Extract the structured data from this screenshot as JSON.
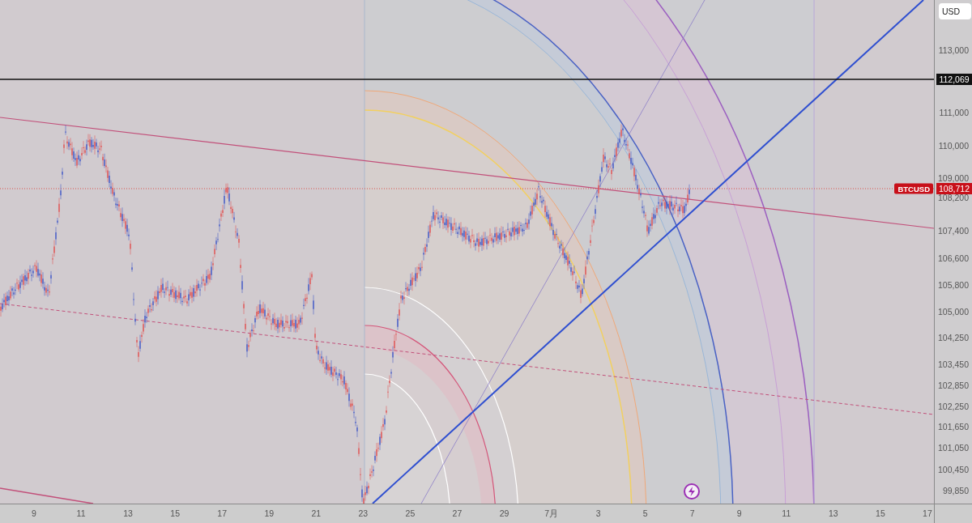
{
  "currency": "USD",
  "price_axis": {
    "ticks": [
      "113,000",
      "111,000",
      "110,000",
      "109,000",
      "108,200",
      "107,400",
      "106,600",
      "105,800",
      "105,000",
      "104,250",
      "103,450",
      "102,850",
      "102,250",
      "101,650",
      "101,050",
      "100,450",
      "99,850"
    ],
    "markers": [
      {
        "kind": "line",
        "value": "112,069"
      },
      {
        "kind": "last",
        "symbol": "BTCUSD",
        "value": "108,712"
      }
    ]
  },
  "time_axis": {
    "ticks": [
      "9",
      "11",
      "13",
      "15",
      "17",
      "19",
      "21",
      "23",
      "25",
      "27",
      "29",
      "7月",
      "3",
      "5",
      "7",
      "9",
      "11",
      "13",
      "15",
      "17"
    ]
  }
}
